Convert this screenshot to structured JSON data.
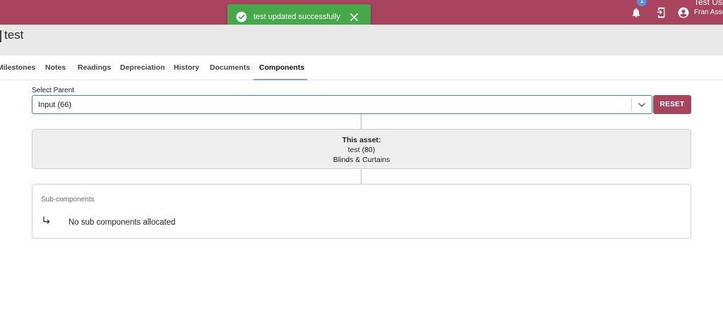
{
  "header": {
    "notification_count": "1",
    "user_name": "Test Use",
    "user_org": "Fran Asse"
  },
  "toast": {
    "message": "test updated successfully"
  },
  "page": {
    "title": "test"
  },
  "tabs": [
    {
      "label": "Milestones"
    },
    {
      "label": "Notes"
    },
    {
      "label": "Readings"
    },
    {
      "label": "Depreciation"
    },
    {
      "label": "History"
    },
    {
      "label": "Documents"
    },
    {
      "label": "Components"
    }
  ],
  "active_tab": "Components",
  "select_parent": {
    "label": "Select Parent",
    "value": "Input (66)",
    "reset_label": "RESET"
  },
  "asset": {
    "heading": "This asset:",
    "name": "test (80)",
    "category": "Blinds & Curtains"
  },
  "subcomponents": {
    "title": "Sub-components",
    "empty_message": "No sub components allocated"
  },
  "colors": {
    "brand": "#a8445f",
    "toast_success": "#46a84b",
    "focus": "#3f7fd6"
  }
}
